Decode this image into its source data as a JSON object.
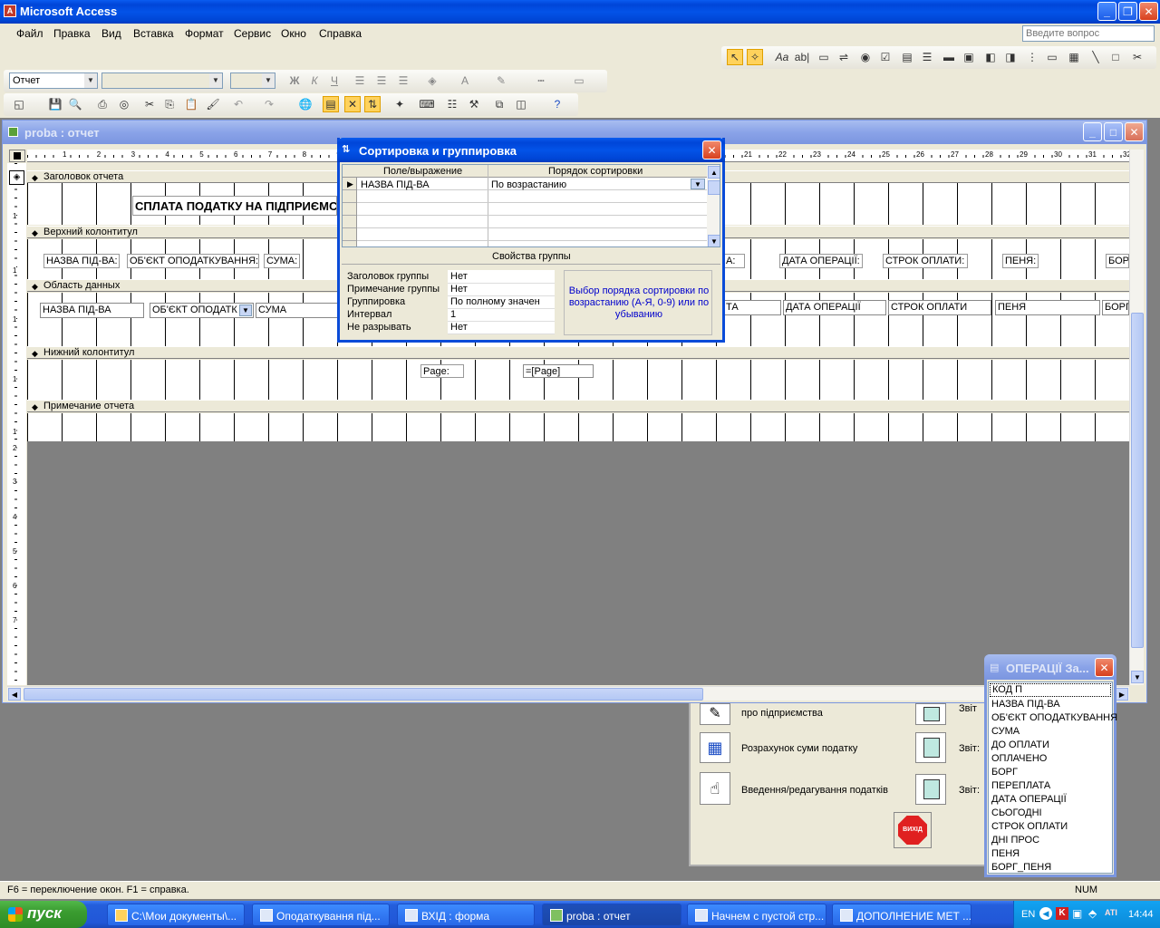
{
  "app": {
    "title": "Microsoft Access",
    "menu": [
      "Файл",
      "Правка",
      "Вид",
      "Вставка",
      "Формат",
      "Сервис",
      "Окно",
      "Справка"
    ],
    "help_placeholder": "Введите вопрос"
  },
  "format_toolbar": {
    "object_select": "Отчет"
  },
  "report_window": {
    "title": "proba : отчет",
    "ruler_marks": [
      "1",
      "2",
      "3",
      "4",
      "5",
      "6",
      "7",
      "8",
      "9",
      "21",
      "22",
      "23",
      "24",
      "25",
      "26",
      "27",
      "28",
      "29",
      "30",
      "31",
      "32"
    ],
    "vruler_marks": [
      "1",
      "1",
      "1",
      "1",
      "1",
      "2",
      "3",
      "4",
      "5",
      "6",
      "7"
    ],
    "sections": {
      "report_header": "Заголовок отчета",
      "page_header": "Верхний колонтитул",
      "detail": "Область данных",
      "page_footer": "Нижний колонтитул",
      "report_footer": "Примечание отчета"
    },
    "report_title_label": "СПЛАТА ПОДАТКУ НА ПІДПРИЄМС",
    "header_labels": [
      "НАЗВА ПІД-ВА:",
      "ОБ'ЄКТ ОПОДАТКУВАННЯ:",
      "СУМА:",
      "А:",
      "ДАТА ОПЕРАЦІЇ:",
      "СТРОК ОПЛАТИ:",
      "ПЕНЯ:",
      "БОР"
    ],
    "detail_fields": [
      "НАЗВА ПІД-ВА",
      "ОБ'ЄКТ ОПОДАТК",
      "СУМА",
      "ТА",
      "ДАТА ОПЕРАЦІЇ",
      "СТРОК ОПЛАТИ",
      "ПЕНЯ",
      "БОРГ"
    ],
    "footer_fields": {
      "page_label": "Page:",
      "page_expr": "=[Page]"
    }
  },
  "sort_dialog": {
    "title": "Сортировка и группировка",
    "col_field": "Поле/выражение",
    "col_order": "Порядок сортировки",
    "rows": [
      {
        "field": "НАЗВА ПІД-ВА",
        "order": "По возрастанию"
      }
    ],
    "group_props_title": "Свойства группы",
    "props": [
      {
        "name": "Заголовок группы",
        "value": "Нет"
      },
      {
        "name": "Примечание группы",
        "value": "Нет"
      },
      {
        "name": "Группировка",
        "value": "По полному значен"
      },
      {
        "name": "Интервал",
        "value": "1"
      },
      {
        "name": "Не разрывать",
        "value": "Нет"
      }
    ],
    "hint": "Выбор порядка сортировки по возрастанию (А-Я, 0-9) или по убыванию"
  },
  "switchboard": {
    "items": [
      {
        "label": "про підприємства",
        "right": "Звіт"
      },
      {
        "label": "Розрахунок суми податку",
        "right": "Звіт:"
      },
      {
        "label": "Введення/редагування податків",
        "right": "Звіт:"
      }
    ],
    "exit_label": "ВИХІД"
  },
  "field_list": {
    "title": "ОПЕРАЦІЇ За...",
    "items": [
      "КОД П",
      "НАЗВА ПІД-ВА",
      "ОБ'ЄКТ ОПОДАТКУВАННЯ",
      "СУМА",
      "ДО ОПЛАТИ",
      "ОПЛАЧЕНО",
      "БОРГ",
      "ПЕРЕПЛАТА",
      "ДАТА ОПЕРАЦІЇ",
      "СЬОГОДНІ",
      "СТРОК ОПЛАТИ",
      "ДНІ ПРОС",
      "ПЕНЯ",
      "БОРГ_ПЕНЯ"
    ]
  },
  "status": {
    "text": "F6 = переключение окон.  F1 = справка.",
    "num": "NUM"
  },
  "taskbar": {
    "start": "пуск",
    "tasks": [
      "C:\\Мои документы\\...",
      "Оподаткування під...",
      "ВХІД : форма",
      "proba : отчет",
      "Начнем с пустой стр...",
      "ДОПОЛНЕНИЕ МЕТ ..."
    ],
    "lang": "EN",
    "clock": "14:44"
  },
  "colors": {
    "accent": "#0a5cf0",
    "hint_text": "#0000cc"
  }
}
